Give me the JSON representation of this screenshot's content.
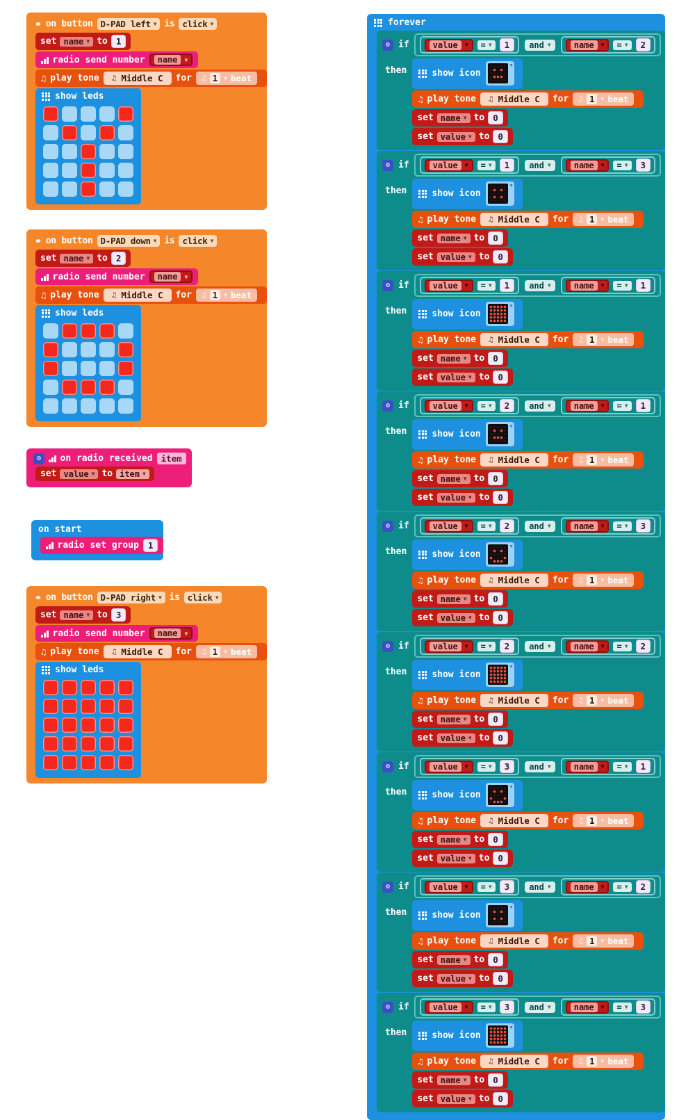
{
  "app": {
    "title": "MakeCode micro:bit blocks workspace"
  },
  "palette": {
    "event_orange": "#F5872A",
    "variable_red": "#C21B17",
    "radio_magenta": "#EC1E79",
    "music_orange": "#E8500E",
    "basic_blue": "#1E90E0",
    "logic_teal": "#0E8C8C",
    "led_on": "#F5281E",
    "led_off": "#A8D8F5",
    "background": "#FFFFFF"
  },
  "labels": {
    "on_button": "on button",
    "is": "is",
    "set": "set",
    "to": "to",
    "radio_send_number": "radio send number",
    "radio_set_group": "radio set group",
    "play_tone": "play tone",
    "for": "for",
    "beat": "beat",
    "show_leds": "show leds",
    "show_icon": "show icon",
    "forever": "forever",
    "if": "if",
    "then": "then",
    "and": "and",
    "on_radio_received": "on radio received",
    "on_start": "on start",
    "equals": "=",
    "click": "click",
    "middle_c": "Middle C",
    "beat_value": "1"
  },
  "scripts": [
    {
      "id": "on-button-dpad-left",
      "kind": "event",
      "button": "D-PAD left",
      "event": "click",
      "set_var": "name",
      "set_value": "1",
      "radio_send_var": "name",
      "tone": "Middle C",
      "beats": "1",
      "leds": [
        [
          1,
          0,
          0,
          0,
          1
        ],
        [
          0,
          1,
          0,
          1,
          0
        ],
        [
          0,
          0,
          1,
          0,
          0
        ],
        [
          0,
          0,
          1,
          0,
          0
        ],
        [
          0,
          0,
          1,
          0,
          0
        ]
      ]
    },
    {
      "id": "on-button-dpad-down",
      "kind": "event",
      "button": "D-PAD down",
      "event": "click",
      "set_var": "name",
      "set_value": "2",
      "radio_send_var": "name",
      "tone": "Middle C",
      "beats": "1",
      "leds": [
        [
          0,
          1,
          1,
          1,
          0
        ],
        [
          1,
          0,
          0,
          0,
          1
        ],
        [
          1,
          0,
          0,
          0,
          1
        ],
        [
          0,
          1,
          1,
          1,
          0
        ],
        [
          0,
          0,
          0,
          0,
          0
        ]
      ]
    },
    {
      "id": "on-radio-received",
      "kind": "radio-received",
      "param": "item",
      "set_var": "value",
      "set_from": "item"
    },
    {
      "id": "on-start",
      "kind": "start",
      "radio_group": "1"
    },
    {
      "id": "on-button-dpad-right",
      "kind": "event",
      "button": "D-PAD right",
      "event": "click",
      "set_var": "name",
      "set_value": "3",
      "radio_send_var": "name",
      "tone": "Middle C",
      "beats": "1",
      "leds": [
        [
          1,
          1,
          1,
          1,
          1
        ],
        [
          1,
          1,
          1,
          1,
          1
        ],
        [
          1,
          1,
          1,
          1,
          1
        ],
        [
          1,
          1,
          1,
          1,
          1
        ],
        [
          1,
          1,
          1,
          1,
          1
        ]
      ]
    }
  ],
  "forever": {
    "label": "forever",
    "branches": [
      {
        "id": "if-value1-name2",
        "left_var": "value",
        "left_op": "=",
        "left_val": "1",
        "conj": "and",
        "right_var": "name",
        "right_op": "=",
        "right_val": "2",
        "icon": [
          [
            0,
            0,
            0,
            0,
            0
          ],
          [
            0,
            1,
            0,
            1,
            0
          ],
          [
            0,
            0,
            0,
            0,
            0
          ],
          [
            0,
            1,
            1,
            1,
            0
          ],
          [
            0,
            0,
            0,
            0,
            0
          ]
        ],
        "tone": "Middle C",
        "beats": "1",
        "reset": [
          {
            "var": "name",
            "val": "0"
          },
          {
            "var": "value",
            "val": "0"
          }
        ]
      },
      {
        "id": "if-value1-name3",
        "left_var": "value",
        "left_op": "=",
        "left_val": "1",
        "conj": "and",
        "right_var": "name",
        "right_op": "=",
        "right_val": "3",
        "icon": [
          [
            0,
            0,
            0,
            0,
            0
          ],
          [
            0,
            1,
            0,
            1,
            0
          ],
          [
            0,
            0,
            0,
            0,
            0
          ],
          [
            0,
            1,
            0,
            1,
            0
          ],
          [
            0,
            0,
            0,
            0,
            0
          ]
        ],
        "tone": "Middle C",
        "beats": "1",
        "reset": [
          {
            "var": "name",
            "val": "0"
          },
          {
            "var": "value",
            "val": "0"
          }
        ]
      },
      {
        "id": "if-value1-name1",
        "left_var": "value",
        "left_op": "=",
        "left_val": "1",
        "conj": "and",
        "right_var": "name",
        "right_op": "=",
        "right_val": "1",
        "icon": [
          [
            1,
            1,
            1,
            1,
            1
          ],
          [
            1,
            1,
            1,
            1,
            1
          ],
          [
            1,
            1,
            1,
            1,
            1
          ],
          [
            1,
            1,
            1,
            1,
            1
          ],
          [
            1,
            1,
            1,
            1,
            1
          ]
        ],
        "tone": "Middle C",
        "beats": "1",
        "reset": [
          {
            "var": "name",
            "val": "0"
          },
          {
            "var": "value",
            "val": "0"
          }
        ]
      },
      {
        "id": "if-value2-name1",
        "left_var": "value",
        "left_op": "=",
        "left_val": "2",
        "conj": "and",
        "right_var": "name",
        "right_op": "=",
        "right_val": "1",
        "icon": [
          [
            0,
            0,
            0,
            0,
            0
          ],
          [
            0,
            1,
            0,
            1,
            0
          ],
          [
            0,
            0,
            0,
            0,
            0
          ],
          [
            0,
            1,
            1,
            1,
            0
          ],
          [
            0,
            0,
            0,
            0,
            0
          ]
        ],
        "tone": "Middle C",
        "beats": "1",
        "reset": [
          {
            "var": "name",
            "val": "0"
          },
          {
            "var": "value",
            "val": "0"
          }
        ]
      },
      {
        "id": "if-value2-name3",
        "left_var": "value",
        "left_op": "=",
        "left_val": "2",
        "conj": "and",
        "right_var": "name",
        "right_op": "=",
        "right_val": "3",
        "icon": [
          [
            0,
            0,
            0,
            0,
            0
          ],
          [
            0,
            1,
            0,
            1,
            0
          ],
          [
            0,
            0,
            0,
            0,
            0
          ],
          [
            1,
            0,
            0,
            0,
            1
          ],
          [
            0,
            1,
            1,
            1,
            0
          ]
        ],
        "tone": "Middle C",
        "beats": "1",
        "reset": [
          {
            "var": "name",
            "val": "0"
          },
          {
            "var": "value",
            "val": "0"
          }
        ]
      },
      {
        "id": "if-value2-name2",
        "left_var": "value",
        "left_op": "=",
        "left_val": "2",
        "conj": "and",
        "right_var": "name",
        "right_op": "=",
        "right_val": "2",
        "icon": [
          [
            1,
            1,
            1,
            1,
            1
          ],
          [
            1,
            1,
            1,
            1,
            1
          ],
          [
            1,
            1,
            1,
            1,
            1
          ],
          [
            1,
            1,
            1,
            1,
            1
          ],
          [
            1,
            1,
            1,
            1,
            1
          ]
        ],
        "tone": "Middle C",
        "beats": "1",
        "reset": [
          {
            "var": "name",
            "val": "0"
          },
          {
            "var": "value",
            "val": "0"
          }
        ]
      },
      {
        "id": "if-value3-name1",
        "left_var": "value",
        "left_op": "=",
        "left_val": "3",
        "conj": "and",
        "right_var": "name",
        "right_op": "=",
        "right_val": "1",
        "icon": [
          [
            0,
            0,
            0,
            0,
            0
          ],
          [
            0,
            1,
            0,
            1,
            0
          ],
          [
            0,
            0,
            0,
            0,
            0
          ],
          [
            1,
            0,
            0,
            0,
            1
          ],
          [
            0,
            1,
            1,
            1,
            0
          ]
        ],
        "tone": "Middle C",
        "beats": "1",
        "reset": [
          {
            "var": "name",
            "val": "0"
          },
          {
            "var": "value",
            "val": "0"
          }
        ]
      },
      {
        "id": "if-value3-name2",
        "left_var": "value",
        "left_op": "=",
        "left_val": "3",
        "conj": "and",
        "right_var": "name",
        "right_op": "=",
        "right_val": "2",
        "icon": [
          [
            0,
            0,
            0,
            0,
            0
          ],
          [
            0,
            1,
            0,
            1,
            0
          ],
          [
            0,
            0,
            0,
            0,
            0
          ],
          [
            0,
            1,
            0,
            1,
            0
          ],
          [
            0,
            0,
            0,
            0,
            0
          ]
        ],
        "tone": "Middle C",
        "beats": "1",
        "reset": [
          {
            "var": "name",
            "val": "0"
          },
          {
            "var": "value",
            "val": "0"
          }
        ]
      },
      {
        "id": "if-value3-name3",
        "left_var": "value",
        "left_op": "=",
        "left_val": "3",
        "conj": "and",
        "right_var": "name",
        "right_op": "=",
        "right_val": "3",
        "icon": [
          [
            1,
            1,
            1,
            1,
            1
          ],
          [
            1,
            1,
            1,
            1,
            1
          ],
          [
            1,
            1,
            1,
            1,
            1
          ],
          [
            1,
            1,
            1,
            1,
            1
          ],
          [
            1,
            1,
            1,
            1,
            1
          ]
        ],
        "tone": "Middle C",
        "beats": "1",
        "reset": [
          {
            "var": "name",
            "val": "0"
          },
          {
            "var": "value",
            "val": "0"
          }
        ]
      }
    ]
  }
}
